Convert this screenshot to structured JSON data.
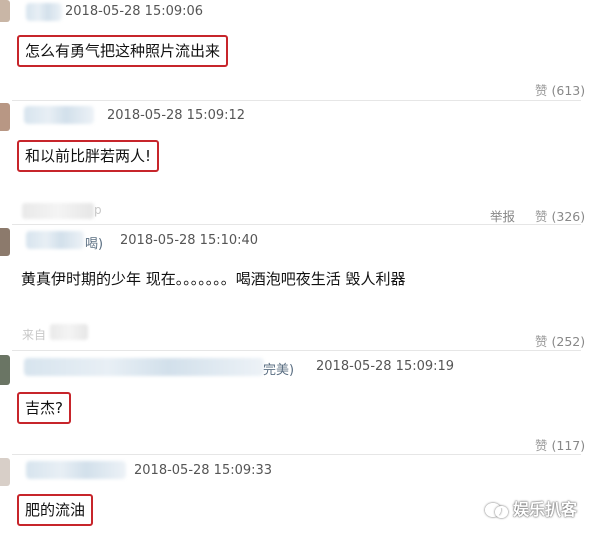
{
  "comments": [
    {
      "timestamp": "2018-05-28 15:09:06",
      "text": "怎么有勇气把这种照片流出来",
      "like_label": "赞",
      "like_count": "(613)"
    },
    {
      "timestamp": "2018-05-28 15:09:12",
      "text": "和以前比胖若两人!",
      "source_tail": "p",
      "report_label": "举报",
      "like_label": "赞",
      "like_count": "(326)"
    },
    {
      "name_tail": "喝)",
      "timestamp": "2018-05-28 15:10:40",
      "text": "黄真伊时期的少年 现在。。。。。。。喝酒泡吧夜生活 毁人利器",
      "source_tail": "来自",
      "like_label": "赞",
      "like_count": "(252)"
    },
    {
      "name_tail": "完美)",
      "timestamp": "2018-05-28 15:09:19",
      "text": "吉杰?",
      "like_label": "赞",
      "like_count": "(117)"
    },
    {
      "timestamp": "2018-05-28 15:09:33",
      "text": "肥的流油"
    }
  ],
  "watermark": {
    "text": "娱乐扒客",
    "icon": "wechat-icon"
  },
  "colors": {
    "highlight_border": "#c7252b",
    "timestamp": "#555555",
    "action": "#888888",
    "separator": "#e6e6e6"
  }
}
